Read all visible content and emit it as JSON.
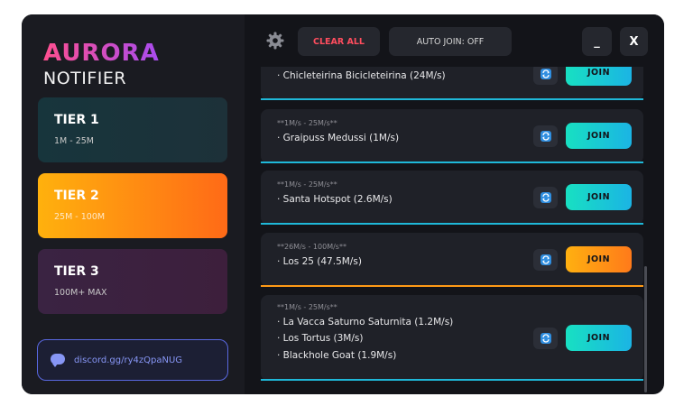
{
  "brand": {
    "title": "AURORA",
    "subtitle": "NOTIFIER"
  },
  "tiers": [
    {
      "name": "TIER 1",
      "range": "1M - 25M"
    },
    {
      "name": "TIER 2",
      "range": "25M - 100M"
    },
    {
      "name": "TIER 3",
      "range": "100M+ MAX"
    }
  ],
  "discord": {
    "text": "discord.gg/ry4zQpaNUG"
  },
  "toolbar": {
    "clear_all": "CLEAR ALL",
    "auto_join": "AUTO JOIN: OFF",
    "minimize": "_",
    "close": "X"
  },
  "cards": [
    {
      "tag": "",
      "items": [
        "· Chicleteirina Bicicleteirina (24M/s)"
      ],
      "join": "JOIN",
      "accent": "#1fb8d8"
    },
    {
      "tag": "**1M/s - 25M/s**",
      "items": [
        "· Graipuss Medussi (1M/s)"
      ],
      "join": "JOIN",
      "accent": "#1fb8d8"
    },
    {
      "tag": "**1M/s - 25M/s**",
      "items": [
        "· Santa Hotspot (2.6M/s)"
      ],
      "join": "JOIN",
      "accent": "#1fb8d8"
    },
    {
      "tag": "**26M/s - 100M/s**",
      "items": [
        "· Los 25 (47.5M/s)"
      ],
      "join": "JOIN",
      "accent": "#ff9a16"
    },
    {
      "tag": "**1M/s - 25M/s**",
      "items": [
        "· La Vacca Saturno Saturnita (1.2M/s)",
        "· Los Tortus (3M/s)",
        "· Blackhole Goat (1.9M/s)"
      ],
      "join": "JOIN",
      "accent": "#1fb8d8"
    }
  ],
  "icons": {
    "settings": "gear-icon",
    "refresh": "refresh-icon",
    "discord": "chat-bubble-icon"
  }
}
